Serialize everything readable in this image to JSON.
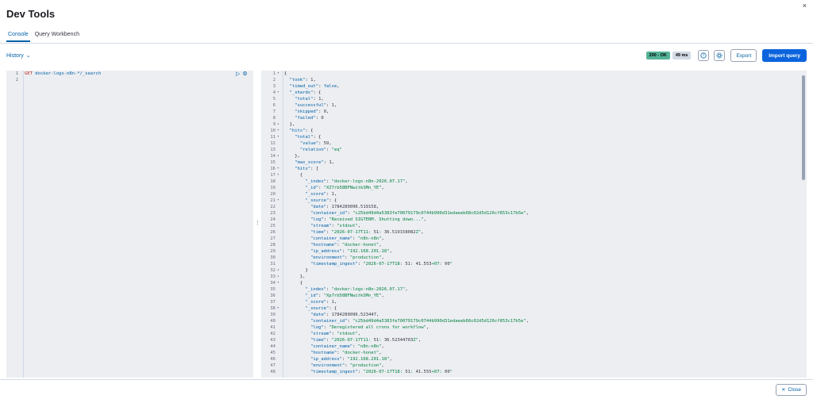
{
  "header": {
    "title": "Dev Tools",
    "close_icon": "×"
  },
  "tabs": [
    {
      "label": "Console",
      "active": true
    },
    {
      "label": "Query Workbench",
      "active": false
    }
  ],
  "history": {
    "label": "History"
  },
  "status": {
    "code": "200 - OK",
    "time": "49 ms"
  },
  "toolbar": {
    "export_label": "Export",
    "import_label": "Import query"
  },
  "request": {
    "lines": [
      {
        "num": "1",
        "method": "GET",
        "path": "docker-logs-n8n-*/_search"
      },
      {
        "num": "2",
        "method": "",
        "path": ""
      }
    ]
  },
  "response": {
    "lines": [
      {
        "num": "1",
        "fold": "▾",
        "text": "{"
      },
      {
        "num": "2",
        "fold": "",
        "text": "  \"took\": 1,"
      },
      {
        "num": "3",
        "fold": "",
        "text": "  \"timed_out\": false,"
      },
      {
        "num": "4",
        "fold": "▾",
        "text": "  \"_shards\": {"
      },
      {
        "num": "5",
        "fold": "",
        "text": "    \"total\": 1,"
      },
      {
        "num": "6",
        "fold": "",
        "text": "    \"successful\": 1,"
      },
      {
        "num": "7",
        "fold": "",
        "text": "    \"skipped\": 0,"
      },
      {
        "num": "8",
        "fold": "",
        "text": "    \"failed\": 0"
      },
      {
        "num": "9",
        "fold": "▴",
        "text": "  },"
      },
      {
        "num": "10",
        "fold": "▾",
        "text": "  \"hits\": {"
      },
      {
        "num": "11",
        "fold": "▾",
        "text": "    \"total\": {"
      },
      {
        "num": "12",
        "fold": "",
        "text": "      \"value\": 59,"
      },
      {
        "num": "13",
        "fold": "",
        "text": "      \"relation\": \"eq\""
      },
      {
        "num": "14",
        "fold": "▴",
        "text": "    },"
      },
      {
        "num": "15",
        "fold": "",
        "text": "    \"max_score\": 1,"
      },
      {
        "num": "16",
        "fold": "▾",
        "text": "    \"hits\": ["
      },
      {
        "num": "17",
        "fold": "▾",
        "text": "      {"
      },
      {
        "num": "18",
        "fold": "",
        "text": "        \"_index\": \"docker-logs-n8n-2026.07.17\","
      },
      {
        "num": "19",
        "fold": "",
        "text": "        \"_id\": \"XZ7rb58BFNwitkSMn_YE\","
      },
      {
        "num": "20",
        "fold": "",
        "text": "        \"_score\": 1,"
      },
      {
        "num": "21",
        "fold": "▾",
        "text": "        \"_source\": {"
      },
      {
        "num": "22",
        "fold": "",
        "text": "          \"date\": 1784289096.519158,"
      },
      {
        "num": "23",
        "fold": "",
        "text": "          \"container_id\": \"c25bd49d4a5383fe70079179c0744b990d31edaeeb68c02d5d126cf853c17b5e\","
      },
      {
        "num": "24",
        "fold": "",
        "text": "          \"log\": \"Received SIGTERM. Shutting down...\","
      },
      {
        "num": "25",
        "fold": "",
        "text": "          \"stream\": \"stdout\","
      },
      {
        "num": "26",
        "fold": "",
        "text": "          \"time\": \"2026-07-17T11:51:36.519158082Z\","
      },
      {
        "num": "27",
        "fold": "",
        "text": "          \"container_name\": \"n8n-n8n\","
      },
      {
        "num": "28",
        "fold": "",
        "text": "          \"hostname\": \"docker-honet\","
      },
      {
        "num": "29",
        "fold": "",
        "text": "          \"ip_address\": \"192.168.201.18\","
      },
      {
        "num": "30",
        "fold": "",
        "text": "          \"environment\": \"production\","
      },
      {
        "num": "31",
        "fold": "",
        "text": "          \"timestamp_ingest\": \"2026-07-17T18:51:41.553+07:00\""
      },
      {
        "num": "32",
        "fold": "▴",
        "text": "        }"
      },
      {
        "num": "33",
        "fold": "▴",
        "text": "      },"
      },
      {
        "num": "34",
        "fold": "▾",
        "text": "      {"
      },
      {
        "num": "35",
        "fold": "",
        "text": "        \"_index\": \"docker-logs-n8n-2026.07.17\","
      },
      {
        "num": "36",
        "fold": "",
        "text": "        \"_id\": \"Xp7rb58BFNwitkSMn_YE\","
      },
      {
        "num": "37",
        "fold": "",
        "text": "        \"_score\": 1,"
      },
      {
        "num": "38",
        "fold": "▾",
        "text": "        \"_source\": {"
      },
      {
        "num": "39",
        "fold": "",
        "text": "          \"date\": 1784289096.523447,"
      },
      {
        "num": "40",
        "fold": "",
        "text": "          \"container_id\": \"c25bd49d4a5383fe70079179c0744b990d31edaeeb68c02d5d126cf853c17b5e\","
      },
      {
        "num": "41",
        "fold": "",
        "text": "          \"log\": \"Deregistered all crons for workflow\","
      },
      {
        "num": "42",
        "fold": "",
        "text": "          \"stream\": \"stdout\","
      },
      {
        "num": "43",
        "fold": "",
        "text": "          \"time\": \"2026-07-17T11:51:36.52344703Z\","
      },
      {
        "num": "44",
        "fold": "",
        "text": "          \"container_name\": \"n8n-n8n\","
      },
      {
        "num": "45",
        "fold": "",
        "text": "          \"hostname\": \"docker-honet\","
      },
      {
        "num": "46",
        "fold": "",
        "text": "          \"ip_address\": \"192.168.201.18\","
      },
      {
        "num": "47",
        "fold": "",
        "text": "          \"environment\": \"production\","
      },
      {
        "num": "48",
        "fold": "",
        "text": "          \"timestamp_ingest\": \"2026-07-17T18:51:41.555+07:00\""
      }
    ]
  },
  "footer": {
    "close_label": "Close",
    "close_icon": "✕"
  },
  "colors": {
    "accent": "#0061a6",
    "primary_button": "#0b64dd",
    "ok_badge": "#54b399",
    "editor_bg": "#eceef2"
  }
}
